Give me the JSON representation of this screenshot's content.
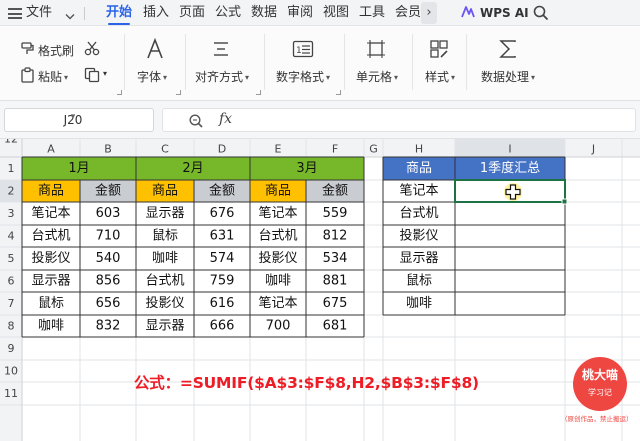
{
  "menubar": {
    "file": "文件",
    "tabs": [
      "开始",
      "插入",
      "页面",
      "公式",
      "数据",
      "审阅",
      "视图",
      "工具",
      "会员"
    ],
    "active_tab": "开始",
    "more": "›",
    "ai": "WPS AI"
  },
  "ribbon": {
    "format_painter": "格式刷",
    "paste": "粘贴",
    "font": "字体",
    "align": "对齐方式",
    "number_format": "数字格式",
    "cell": "单元格",
    "style": "样式",
    "data_process": "数据处理"
  },
  "formula_bar": {
    "name_box": "J20",
    "fx": "fx",
    "formula": ""
  },
  "sheet": {
    "columns": [
      "A",
      "B",
      "C",
      "D",
      "E",
      "F",
      "G",
      "H",
      "I",
      "J"
    ],
    "rows": [
      "1",
      "2",
      "3",
      "4",
      "5",
      "6",
      "7",
      "8",
      "9",
      "10",
      "11",
      "12"
    ],
    "selected_column": "I",
    "selected_row": "2",
    "colors": {
      "month_header": "#76b82a",
      "item_header": "#ffc000",
      "amount_header": "#c9ccd1",
      "summary_header": "#4472c4",
      "selection": "#1e7145"
    },
    "left_table": {
      "months": [
        "1月",
        "2月",
        "3月"
      ],
      "item_label": "商品",
      "amount_label": "金额",
      "blocks": [
        {
          "items": [
            "笔记本",
            "台式机",
            "投影仪",
            "显示器",
            "鼠标",
            "咖啡"
          ],
          "amounts": [
            "603",
            "710",
            "540",
            "856",
            "656",
            "832"
          ]
        },
        {
          "items": [
            "显示器",
            "鼠标",
            "咖啡",
            "台式机",
            "投影仪",
            "显示器"
          ],
          "amounts": [
            "676",
            "631",
            "574",
            "759",
            "616",
            "666"
          ]
        },
        {
          "items": [
            "笔记本",
            "台式机",
            "投影仪",
            "咖啡",
            "笔记本",
            "700"
          ],
          "amounts": [
            "559",
            "812",
            "534",
            "881",
            "675",
            "681"
          ]
        }
      ]
    },
    "right_table": {
      "header_item": "商品",
      "header_total": "1季度汇总",
      "items": [
        "笔记本",
        "台式机",
        "投影仪",
        "显示器",
        "鼠标",
        "咖啡"
      ]
    }
  },
  "note": {
    "formula": "公式：=SUMIF($A$3:$F$8,H2,$B$3:$F$8)"
  },
  "badge": {
    "title": "桃大喵",
    "subtitle": "学习记",
    "watermark": "（原创作品，禁止搬运）"
  }
}
